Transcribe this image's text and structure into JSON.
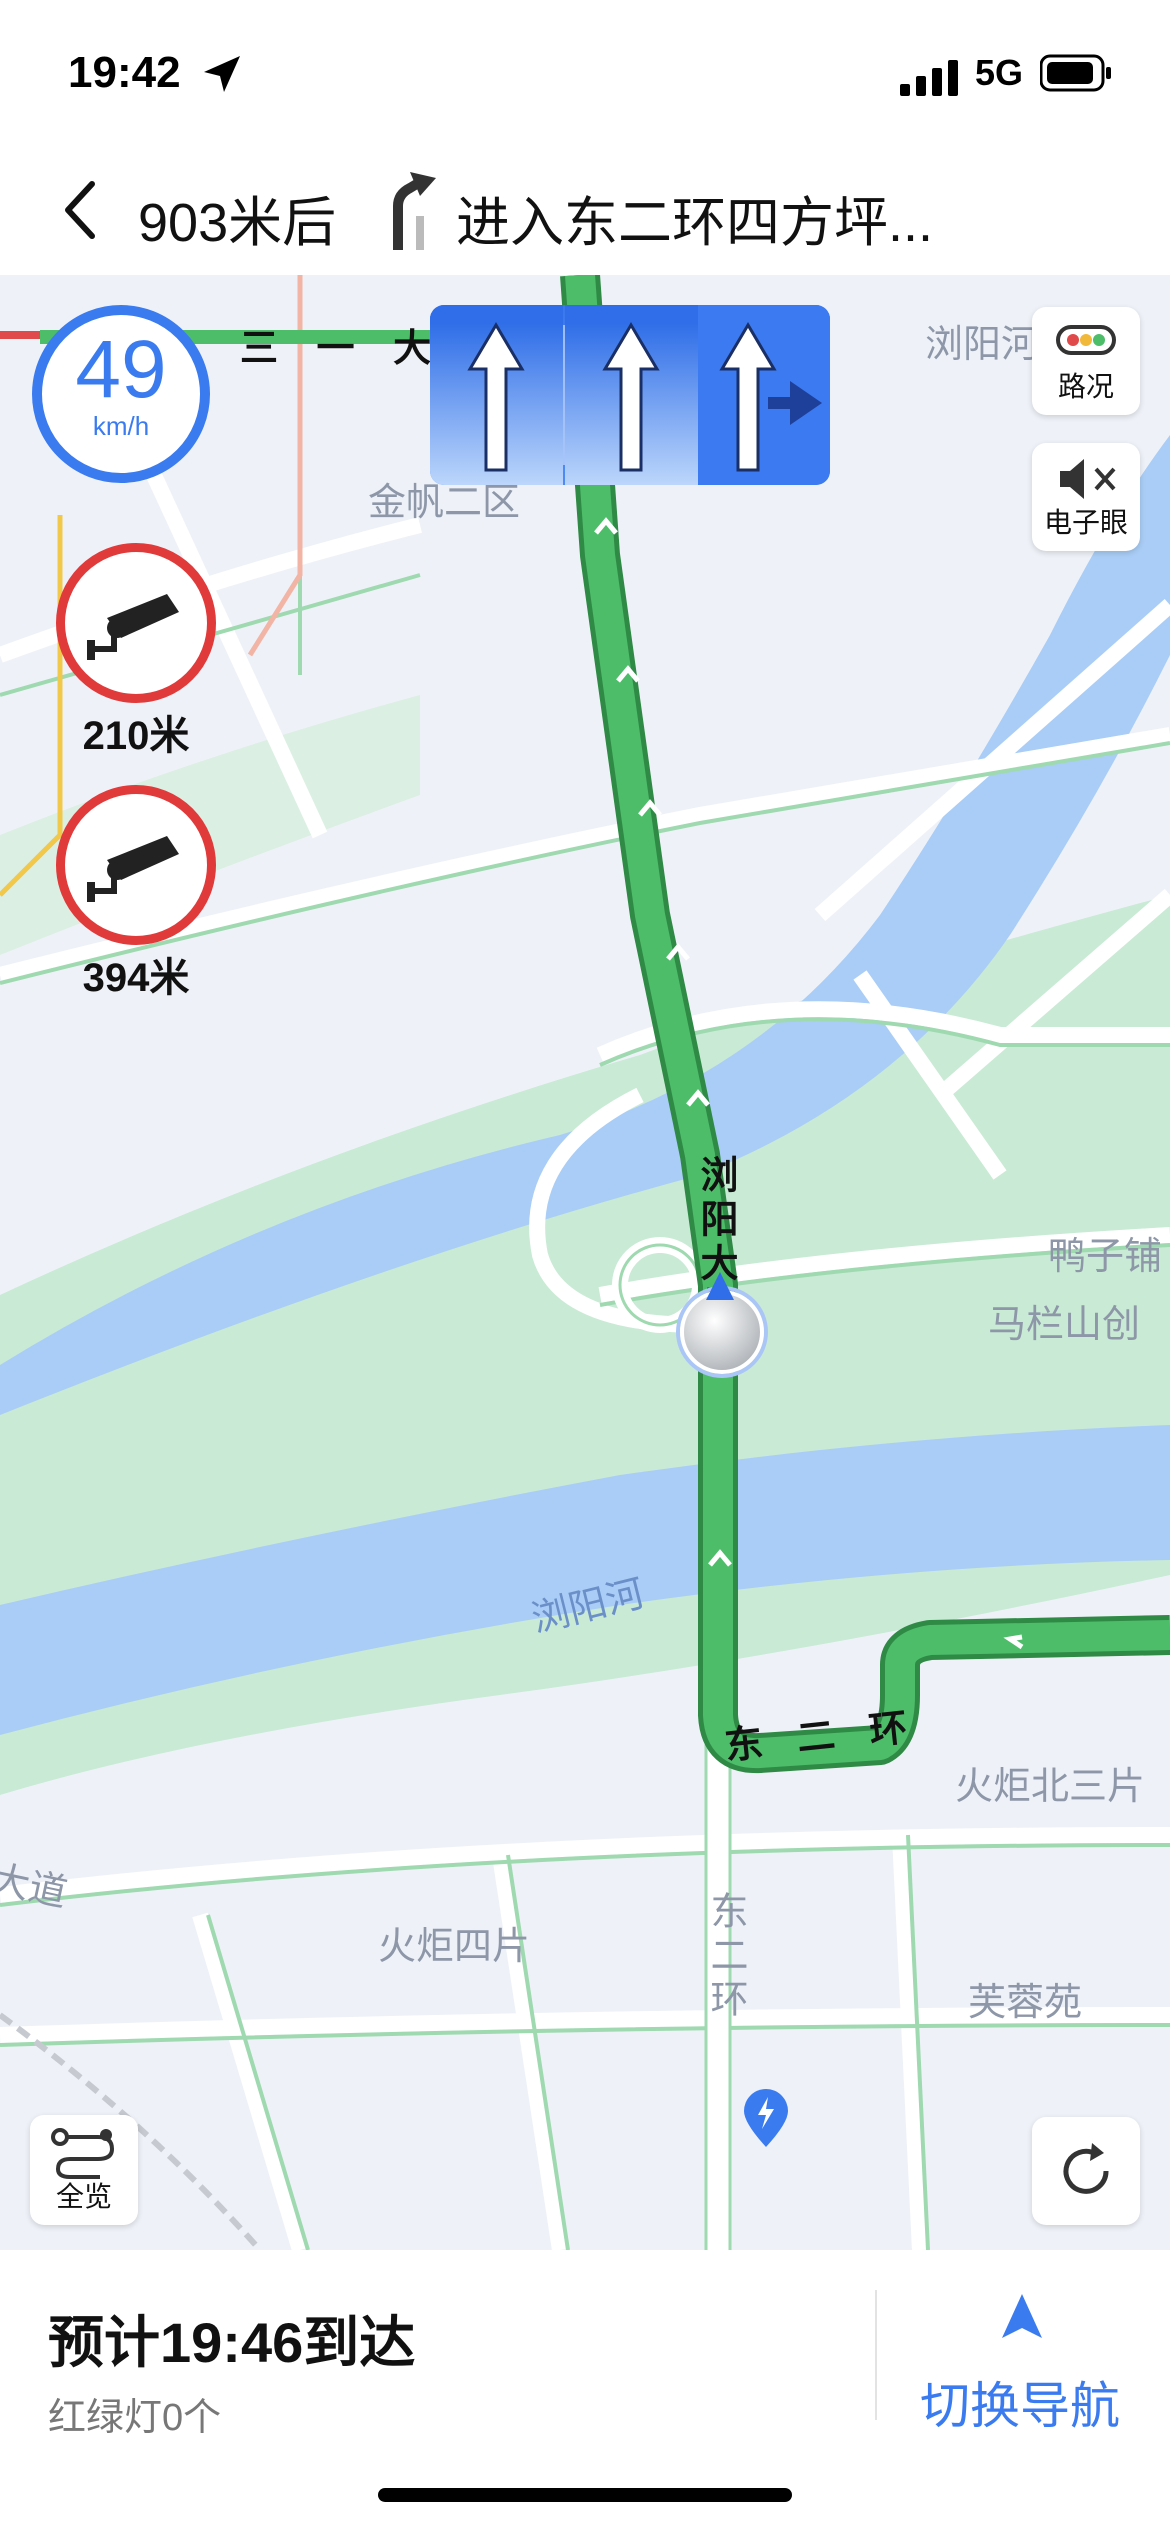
{
  "status_bar": {
    "time": "19:42",
    "network": "5G",
    "icons": [
      "location-arrow-icon",
      "signal-icon",
      "battery-icon"
    ]
  },
  "header": {
    "distance": "903米后",
    "road": "进入东二环四方坪...",
    "icons": [
      "back-icon",
      "turn-slight-right-icon"
    ]
  },
  "speed": {
    "value": "49",
    "unit": "km/h"
  },
  "cameras": [
    {
      "distance": "210米",
      "icon": "camera-icon"
    },
    {
      "distance": "394米",
      "icon": "camera-icon"
    }
  ],
  "lane_guide": {
    "lanes": [
      "straight",
      "straight",
      "straight-right"
    ],
    "active_lane": 3
  },
  "side_buttons": {
    "traffic": "路况",
    "camera_toggle": "电子眼",
    "overview": "全览"
  },
  "map_labels": {
    "road_top": "三 一 大",
    "area_jinfan": "金帆二区",
    "river_top_right": "浏阳河",
    "bridge": "浏阳大桥",
    "yazipu": "鸭子铺",
    "malanshan": "马栏山创",
    "river_middle": "浏阳河",
    "ring_road": "东 二 环",
    "huoju_north": "火炬北三片",
    "huoju_four": "火炬四片",
    "avenue": "大道",
    "ring_road_vertical": "东二环",
    "furongyuan": "芙蓉苑"
  },
  "colors": {
    "route": "#4dbd6a",
    "river": "#a9cdf6",
    "park": "#c9ead5",
    "accent_blue": "#3a7bf0",
    "camera_red": "#e03a3a"
  },
  "bottom": {
    "eta": "预计19:46到达",
    "traffic_lights": "红绿灯0个",
    "switch_nav": "切换导航"
  }
}
